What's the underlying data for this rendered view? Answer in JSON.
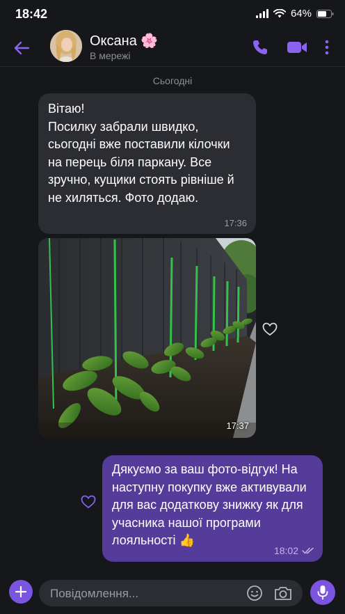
{
  "status_bar": {
    "time": "18:42",
    "battery_pct": "64%"
  },
  "header": {
    "contact_name": "Оксана 🌸",
    "contact_status": "В мережі"
  },
  "chat": {
    "date_separator": "Сьогодні",
    "incoming_text": {
      "text": "Вітаю!\nПосилку забрали швидко, сьогодні вже поставили кілочки на перець біля паркану. Все зручно, кущики стоять рівніше й не хиляться. Фото додаю.",
      "time": "17:36"
    },
    "incoming_photo": {
      "time": "17:37"
    },
    "outgoing_text": {
      "text": "Дякуємо за ваш фото-відгук! На наступну покупку вже активували для вас додаткову знижку як для учасника нашої програми лояльності 👍",
      "time": "18:02"
    }
  },
  "compose": {
    "placeholder": "Повідомлення..."
  },
  "colors": {
    "accent": "#7b55e0",
    "outgoing_bubble": "#553c9a",
    "incoming_bubble": "#2b2d33",
    "background": "#16171b"
  }
}
